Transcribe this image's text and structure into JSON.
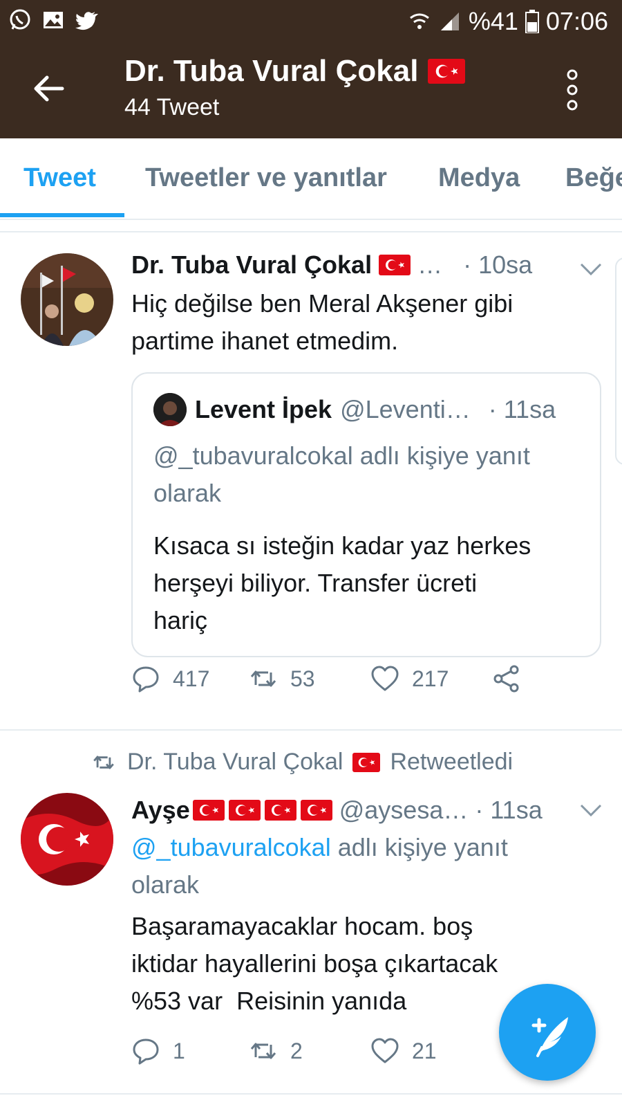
{
  "status_bar": {
    "battery": "%41",
    "time": "07:06",
    "left_icons": [
      "whatsapp-icon",
      "gallery-icon",
      "twitter-icon"
    ],
    "right_icons": [
      "wifi-icon",
      "signal-icon",
      "battery-icon"
    ]
  },
  "header": {
    "title": "Dr. Tuba Vural Çokal",
    "subtitle": "44 Tweet",
    "title_flag": "turkey-flag-icon"
  },
  "tabs": [
    {
      "label": "Tweet",
      "active": true
    },
    {
      "label": "Tweetler ve yanıtlar",
      "active": false
    },
    {
      "label": "Medya",
      "active": false
    },
    {
      "label": "Beğe",
      "active": false
    }
  ],
  "tweet1": {
    "name": "Dr. Tuba Vural Çokal",
    "ellipsis": "…",
    "time": "· 10sa",
    "text_line1": "Hiç değilse ben Meral Akşener gibi",
    "text_line2": "partime ihanet etmedim.",
    "quote": {
      "name": "Levent İpek",
      "handle": "@Leventi…",
      "time": "· 11sa",
      "reply_line1": "@_tubavuralcokal adlı kişiye yanıt",
      "reply_line2": "olarak",
      "text_line1": "Kısaca sı isteğin kadar yaz herkes",
      "text_line2": "herşeyi biliyor. Transfer ücreti",
      "text_line3": "hariç"
    },
    "replies": "417",
    "retweets": "53",
    "likes": "217"
  },
  "retweet_banner": {
    "name": "Dr. Tuba Vural Çokal",
    "action": "Retweetledi"
  },
  "tweet2": {
    "name": "Ayşe",
    "handle": "@aysesa…",
    "time": "· 11sa",
    "reply_mention": "@_tubavuralcokal",
    "reply_rest": " adlı kişiye yanıt",
    "reply_line2": "olarak",
    "text_line1": "Başaramayacaklar hocam. boş",
    "text_line2": "iktidar hayallerini boşa çıkartacak",
    "text_line3": "%53 var  Reisinin yanıda",
    "replies": "1",
    "retweets": "2",
    "likes": "21"
  },
  "colors": {
    "header_bg": "#3b2b20",
    "accent": "#1da1f2",
    "muted": "#657786"
  }
}
